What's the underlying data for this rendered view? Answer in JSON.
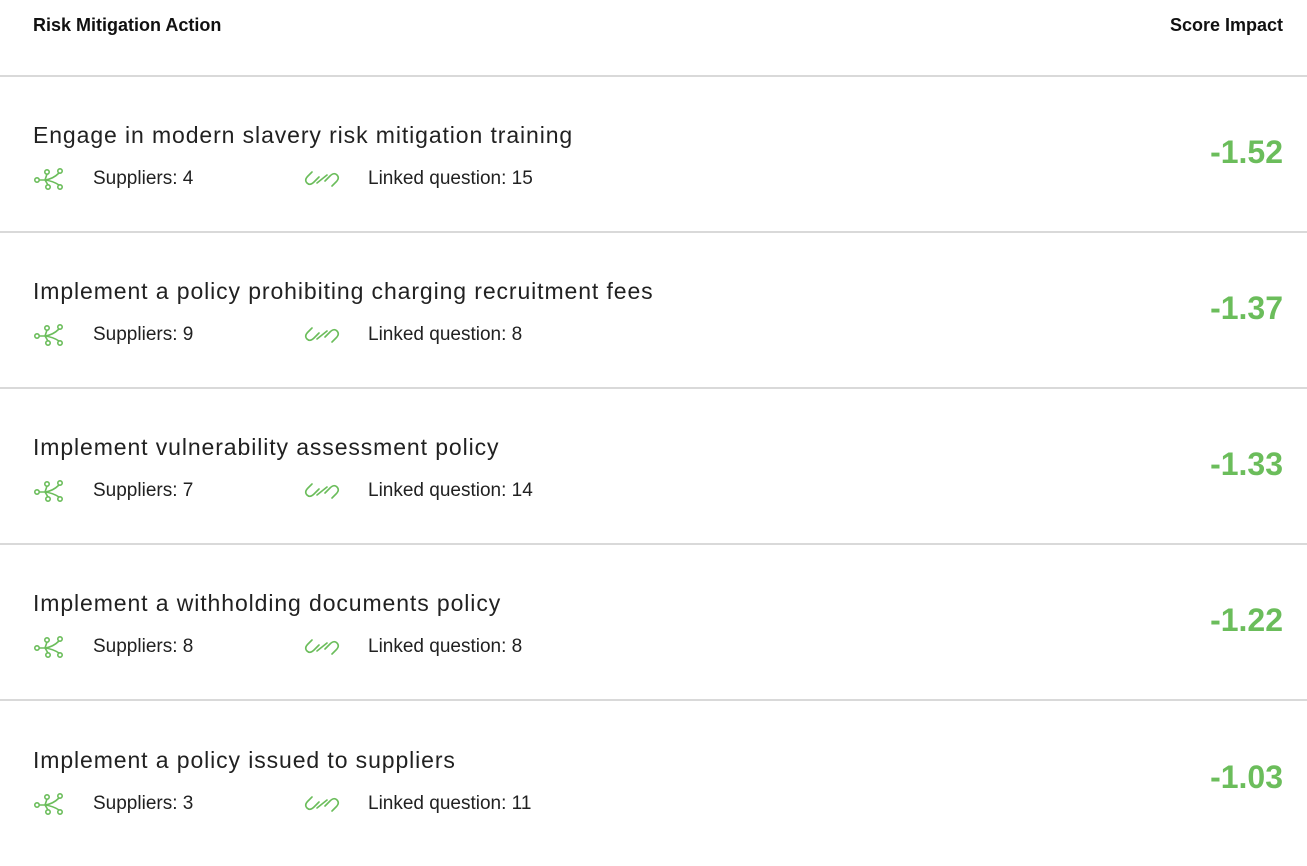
{
  "header": {
    "action_label": "Risk Mitigation Action",
    "score_label": "Score Impact"
  },
  "rows": [
    {
      "title": "Engage in modern slavery risk mitigation training",
      "suppliers_text": "Suppliers: 4",
      "linked_text": "Linked question: 15",
      "score": "-1.52"
    },
    {
      "title": "Implement a policy prohibiting charging recruitment fees",
      "suppliers_text": "Suppliers: 9",
      "linked_text": "Linked question: 8",
      "score": "-1.37"
    },
    {
      "title": "Implement vulnerability assessment policy",
      "suppliers_text": "Suppliers: 7",
      "linked_text": "Linked question: 14",
      "score": "-1.33"
    },
    {
      "title": "Implement a withholding documents policy",
      "suppliers_text": "Suppliers: 8",
      "linked_text": "Linked question: 8",
      "score": "-1.22"
    },
    {
      "title": "Implement a policy issued to suppliers",
      "suppliers_text": "Suppliers: 3",
      "linked_text": "Linked question: 11",
      "score": "-1.03"
    }
  ],
  "icons": {
    "suppliers": "network-nodes-icon",
    "linked": "chain-link-icon"
  },
  "colors": {
    "accent_green": "#6bbd5b",
    "divider": "#d9d9d9",
    "text": "#212121"
  }
}
